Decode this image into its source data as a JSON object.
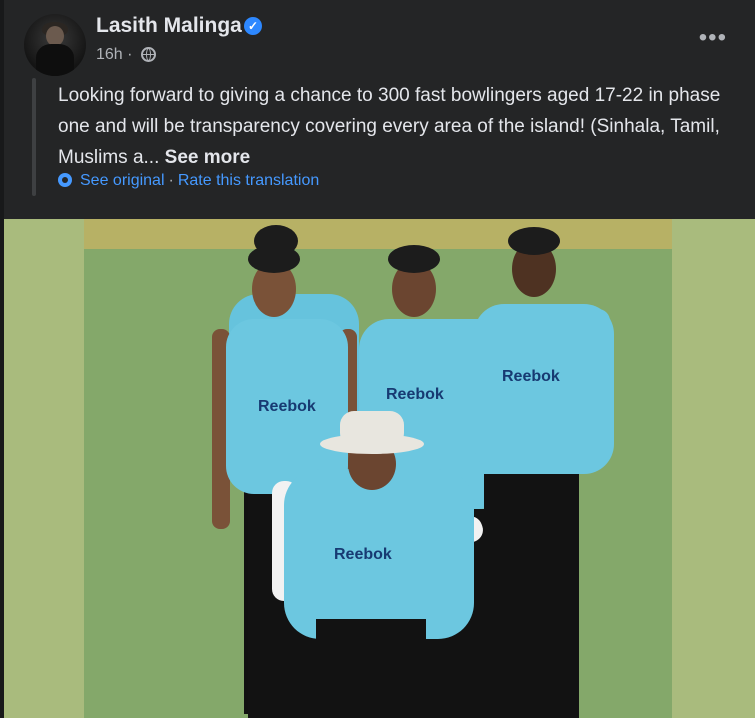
{
  "post": {
    "author": "Lasith Malinga",
    "time": "16h",
    "separator": "·",
    "more_label": "•••",
    "text": "Looking forward to giving a chance to 300 fast bowlingers aged 17-22 in phase one and will be transparency covering every area of the island! (Sinhala, Tamil, Muslims a...",
    "see_more": "See more",
    "see_original": "See original",
    "rate_translation": "Rate this translation"
  },
  "photo": {
    "jersey_brand": "Reebok"
  },
  "icons": {
    "verified": "verified-badge-icon",
    "privacy": "globe-icon",
    "more": "more-options-icon",
    "translate": "gear-icon"
  },
  "colors": {
    "background": "#242526",
    "text": "#e4e6eb",
    "secondary": "#b0b3b8",
    "link": "#4599ff",
    "verified": "#2d88ff"
  }
}
